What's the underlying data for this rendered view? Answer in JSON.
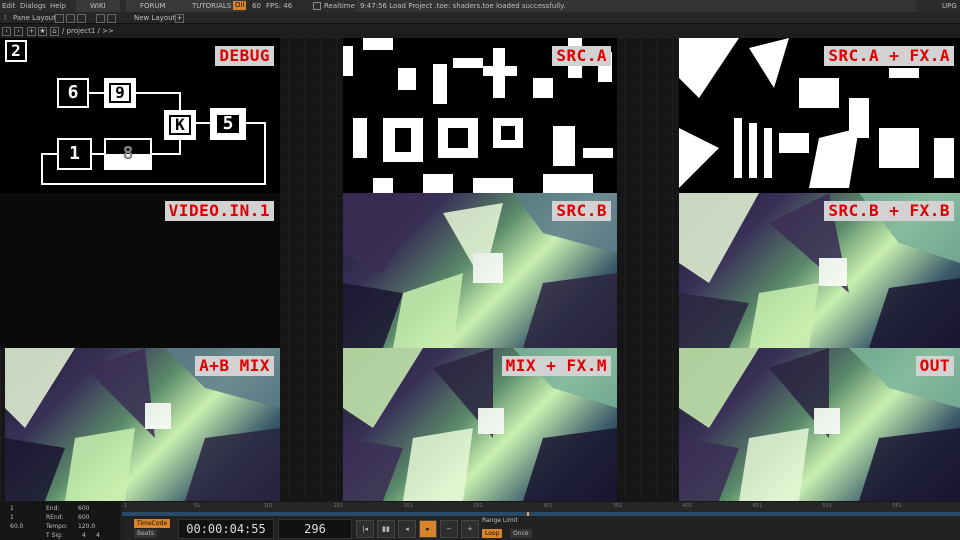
{
  "menubar": {
    "edit": "Edit",
    "dialogs": "Dialogs",
    "help": "Help",
    "wiki": "WIKI",
    "forum": "FORUM",
    "tutorials": "TUTORIALS",
    "oil_badge": "Oil",
    "fps_small": "60",
    "fps": "FPS: 46",
    "realtime": "Realtime",
    "status": "9:47:56 Load Project .toe: shaders.toe loaded successfully.",
    "upgrade": "UPG"
  },
  "panebar": {
    "pane_layout": "Pane Layout",
    "new_layout": "New Layout"
  },
  "pathbar": {
    "path": "/ project1 / >>",
    "pane_number": "2"
  },
  "tiles": {
    "debug": "DEBUG",
    "src_a": "SRC.A",
    "src_a_fx": "SRC.A + FX.A",
    "video_in": "VIDEO.IN.1",
    "src_b": "SRC.B",
    "src_b_fx": "SRC.B + FX.B",
    "ab_mix": "A+B MIX",
    "mix_fx": "MIX + FX.M",
    "out": "OUT"
  },
  "debug_nodes": {
    "n6": "6",
    "n9": "9",
    "nk": "K",
    "n5": "5",
    "n1": "1",
    "n8": "8"
  },
  "timeline": {
    "left": {
      "a1": "1",
      "a2": "1",
      "a3": "60.0",
      "end_label": "End:",
      "end_val": "600",
      "rend_label": "REnd:",
      "rend_val": "600",
      "tempo_label": "Tempo:",
      "tempo_val": "120.0",
      "tsig_label": "T Sig:",
      "tsig_a": "4",
      "tsig_b": "4"
    },
    "ruler_ticks": [
      "1",
      "51",
      "101",
      "151",
      "201",
      "251",
      "301",
      "351",
      "401",
      "451",
      "501",
      "551"
    ],
    "timecode_btn": "TimeCode",
    "beats_btn": "Beats",
    "timecode": "00:00:04:55",
    "frame": "296",
    "range_limit": "Range Limit",
    "loop": "Loop",
    "once": "Once"
  },
  "colors": {
    "label_bg": "#d2d2d2",
    "label_fg": "#e00000",
    "accent_orange": "#d9832a"
  }
}
